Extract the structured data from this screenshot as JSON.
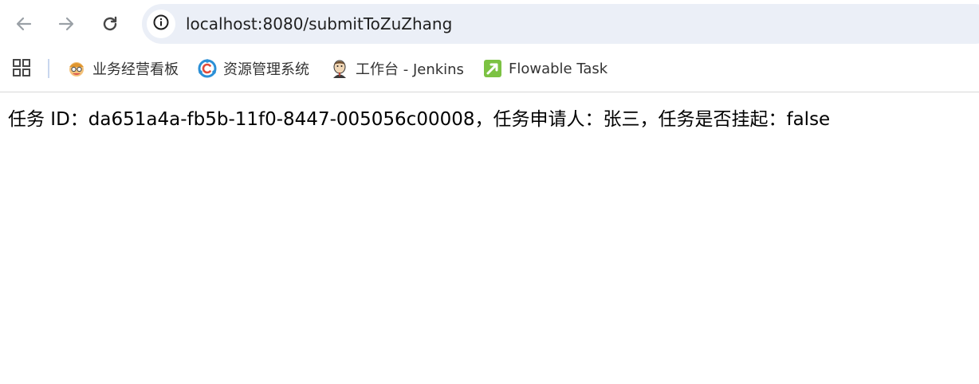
{
  "toolbar": {
    "url": "localhost:8080/submitToZuZhang"
  },
  "bookmarks": {
    "items": [
      {
        "label": "业务经营看板",
        "icon": "avatar-bookmark-icon"
      },
      {
        "label": "资源管理系统",
        "icon": "resource-system-icon"
      },
      {
        "label": "工作台 - Jenkins",
        "icon": "jenkins-icon"
      },
      {
        "label": "Flowable Task",
        "icon": "flowable-icon"
      }
    ]
  },
  "page": {
    "message": "任务 ID：da651a4a-fb5b-11f0-8447-005056c00008，任务申请人：张三，任务是否挂起：false"
  },
  "colors": {
    "omnibox_bg": "#ebeff7",
    "flowable_green": "#7cc243",
    "resource_blue": "#2b8fd6",
    "text": "#1f1f1f"
  }
}
